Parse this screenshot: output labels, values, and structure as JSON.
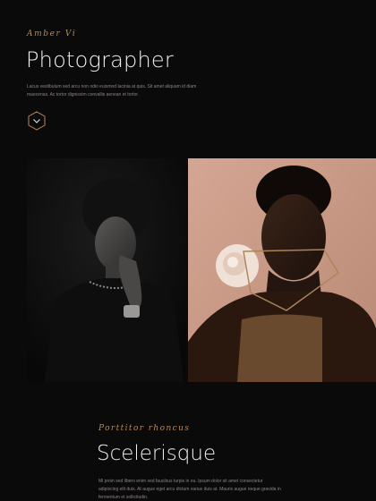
{
  "hero": {
    "script_subtitle": "Amber Vi",
    "title": "Photographer",
    "description": "Lacus vestibulum sed arcu non odio euismod lacinia at quis. Sit amet aliquam id diam maecenas. Ac tortor dignissim convallis aenean et tortor.",
    "scroll_icon": "chevron-down-icon"
  },
  "section": {
    "script_subtitle": "Porttitor rhoncus",
    "title": "Scelerisque",
    "description": "Mi proin sed libero enim sed faucibus turpis in eu. Ipsum dolor sit amet consectetur adipiscing elit duis. At augue eget arcu dictum varius duis at. Mauris augue neque gravida in fermentum et sollicitudin."
  },
  "colors": {
    "background": "#0b0a0a",
    "accent": "#b88a52",
    "right_photo_backdrop": "#c99a86"
  }
}
